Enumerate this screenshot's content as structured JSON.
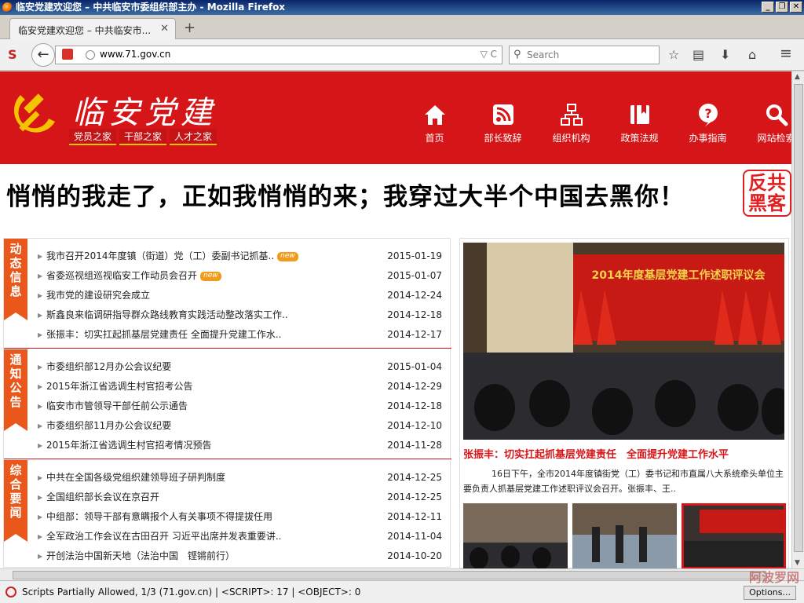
{
  "window": {
    "title": "临安党建欢迎您 – 中共临安市委组织部主办 - Mozilla Firefox",
    "btn_min": "_",
    "btn_max": "❐",
    "btn_close": "✕"
  },
  "tab": {
    "label": "临安党建欢迎您 – 中共临安市...",
    "close": "✕",
    "new_tab": "+"
  },
  "nav": {
    "back": "←",
    "url": "www.71.gov.cn",
    "url_end": "▽ C",
    "search_placeholder": "Search",
    "search_icon": "magnifier-icon",
    "icons": [
      "bookmark-star-icon",
      "reading-list-icon",
      "download-icon",
      "home-icon",
      "menu-icon"
    ],
    "glyphs": {
      "star": "☆",
      "list": "▤",
      "download": "⬇",
      "home": "⌂",
      "menu": "≡",
      "search": "⚲"
    }
  },
  "site": {
    "logo_text": "临安党建",
    "logo_links": [
      "党员之家",
      "干部之家",
      "人才之家"
    ],
    "topnav": [
      {
        "label": "首页",
        "icon": "home-icon"
      },
      {
        "label": "部长致辞",
        "icon": "rss-icon"
      },
      {
        "label": "组织机构",
        "icon": "org-chart-icon"
      },
      {
        "label": "政策法规",
        "icon": "book-icon"
      },
      {
        "label": "办事指南",
        "icon": "question-icon"
      },
      {
        "label": "网站检索",
        "icon": "search-icon"
      }
    ],
    "brand_red": "#d61518",
    "accent_orange": "#e9571a"
  },
  "banner": {
    "text": "悄悄的我走了，正如我悄悄的来；我穿过大半个中国去黑你！",
    "badge_line1": "反共",
    "badge_line2": "黑客"
  },
  "sections": [
    {
      "title_chars": [
        "动",
        "态",
        "信",
        "息"
      ],
      "items": [
        {
          "title": "我市召开2014年度镇（街道）党（工）委副书记抓基..",
          "date": "2015-01-19",
          "new": true
        },
        {
          "title": "省委巡视组巡视临安工作动员会召开",
          "date": "2015-01-07",
          "new": true
        },
        {
          "title": "我市党的建设研究会成立",
          "date": "2014-12-24",
          "new": false
        },
        {
          "title": "斯鑫良来临调研指导群众路线教育实践活动整改落实工作..",
          "date": "2014-12-18",
          "new": false
        },
        {
          "title": "张振丰：切实扛起抓基层党建责任 全面提升党建工作水..",
          "date": "2014-12-17",
          "new": false
        }
      ]
    },
    {
      "title_chars": [
        "通",
        "知",
        "公",
        "告"
      ],
      "items": [
        {
          "title": "市委组织部12月办公会议纪要",
          "date": "2015-01-04",
          "new": false
        },
        {
          "title": "2015年浙江省选调生村官招考公告",
          "date": "2014-12-29",
          "new": false
        },
        {
          "title": "临安市市管领导干部任前公示通告",
          "date": "2014-12-18",
          "new": false
        },
        {
          "title": "市委组织部11月办公会议纪要",
          "date": "2014-12-10",
          "new": false
        },
        {
          "title": "2015年浙江省选调生村官招考情况预告",
          "date": "2014-11-28",
          "new": false
        }
      ]
    },
    {
      "title_chars": [
        "综",
        "合",
        "要",
        "闻"
      ],
      "items": [
        {
          "title": "中共在全国各级党组织建领导班子研判制度",
          "date": "2014-12-25",
          "new": false
        },
        {
          "title": "全国组织部长会议在京召开",
          "date": "2014-12-25",
          "new": false
        },
        {
          "title": "中组部：领导干部有意瞒报个人有关事项不得提拔任用",
          "date": "2014-12-11",
          "new": false
        },
        {
          "title": "全军政治工作会议在古田召开 习近平出席并发表重要讲..",
          "date": "2014-11-04",
          "new": false
        },
        {
          "title": "开创法治中国新天地（法治中国　铿锵前行）",
          "date": "2014-10-20",
          "new": false
        }
      ]
    }
  ],
  "new_badge": "new",
  "featured": {
    "photo_banner": "2014年度基层党建工作述职评议会",
    "title": "张振丰：切实扛起抓基层党建责任　全面提升党建工作水平",
    "desc": "16日下午，全市2014年度镇街党（工）委书记和市直属八大系统牵头单位主要负责人抓基层党建工作述职评议会召开。张振丰、王.."
  },
  "status": {
    "text": "Scripts Partially Allowed, 1/3 (71.gov.cn) | <SCRIPT>: 17 | <OBJECT>: 0",
    "options": "Options...",
    "watermark": "阿波罗网"
  }
}
